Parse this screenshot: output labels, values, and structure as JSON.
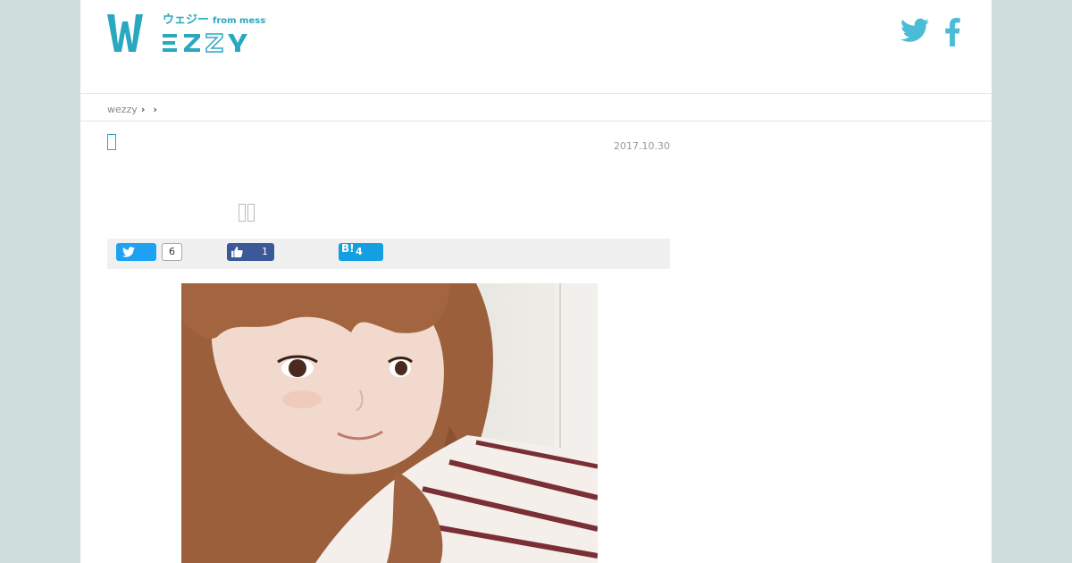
{
  "header": {
    "logo_main": "WEZZY",
    "logo_kana": "ウェジー",
    "logo_from": "from messy"
  },
  "breadcrumb": {
    "home": "wezzy",
    "sep1": "›",
    "sep2": "›"
  },
  "article": {
    "date": "2017.10.30"
  },
  "share": {
    "twitter_count": "6",
    "facebook_count": "1",
    "hatena_label": "B!",
    "hatena_count": "4"
  },
  "colors": {
    "accent": "#2aa8c0",
    "background": "#cddedd",
    "twitter": "#1da1f2",
    "facebook": "#3b5998",
    "hatena": "#139fe2"
  }
}
